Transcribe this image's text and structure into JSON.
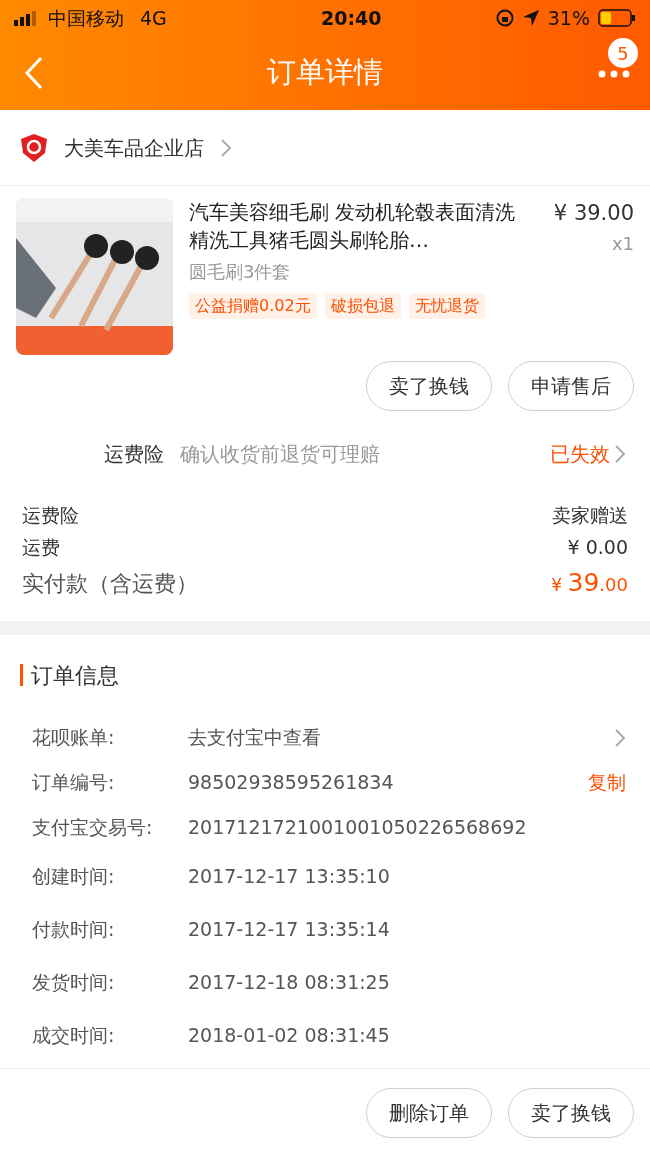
{
  "status_bar": {
    "carrier": "中国移动",
    "network": "4G",
    "time": "20:40",
    "battery": "31%"
  },
  "nav": {
    "title": "订单详情",
    "badge": "5"
  },
  "store": {
    "name": "大美车品企业店"
  },
  "product": {
    "title": "汽车美容细毛刷 发动机轮毂表面清洗精洗工具猪毛圆头刷轮胎…",
    "price": "¥ 39.00",
    "quantity": "x1",
    "variant": "圆毛刷3件套",
    "tags": [
      "公益捐赠0.02元",
      "破损包退",
      "无忧退货"
    ]
  },
  "product_actions": [
    "卖了换钱",
    "申请售后"
  ],
  "freight_insurance": {
    "label": "运费险",
    "description": "确认收货前退货可理赔",
    "status": "已失效"
  },
  "summary": [
    {
      "kind": "plain",
      "label": "运费险",
      "value": "卖家赠送"
    },
    {
      "kind": "plain",
      "label": "运费",
      "value": "¥ 0.00"
    }
  ],
  "total": {
    "label": "实付款（含运费）",
    "currency": "¥",
    "amount": "39",
    "decimals": ".00"
  },
  "order_info": {
    "title": "订单信息",
    "rows": [
      {
        "label": "花呗账单:",
        "value": "去支付宝中查看",
        "kind": "link"
      },
      {
        "label": "订单编号:",
        "value": "98502938595261834",
        "kind": "copy",
        "action": "复制"
      },
      {
        "label": "支付宝交易号:",
        "value": "2017121721001001050226568692",
        "kind": "plain"
      },
      {
        "label": "创建时间:",
        "value": "2017-12-17 13:35:10",
        "kind": "plain"
      },
      {
        "label": "付款时间:",
        "value": "2017-12-17 13:35:14",
        "kind": "plain"
      },
      {
        "label": "发货时间:",
        "value": "2017-12-18 08:31:25",
        "kind": "plain"
      },
      {
        "label": "成交时间:",
        "value": "2018-01-02 08:31:45",
        "kind": "plain"
      }
    ]
  },
  "bottom_actions": [
    "删除订单",
    "卖了换钱"
  ]
}
